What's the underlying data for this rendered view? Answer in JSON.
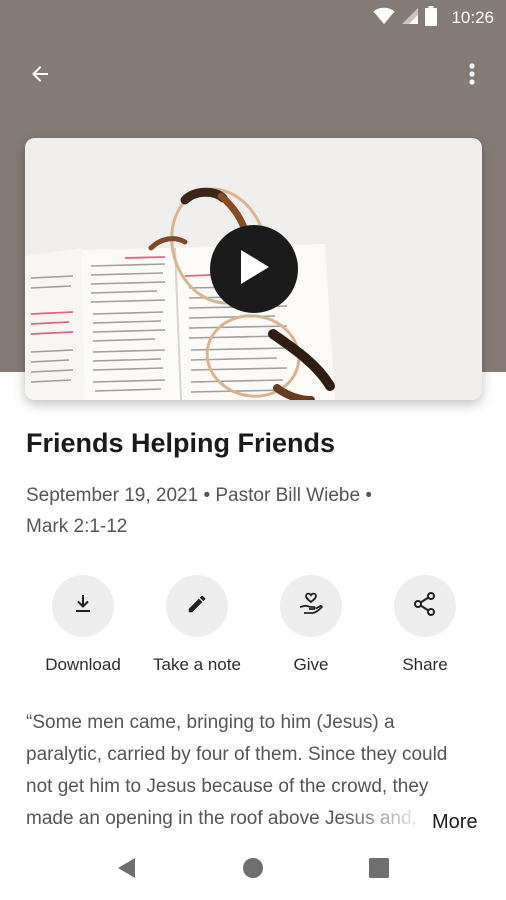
{
  "status_bar": {
    "time": "10:26"
  },
  "app_bar": {
    "back_icon": "arrow-left-icon",
    "menu_icon": "more-vertical-icon",
    "header_color": "#857b76"
  },
  "video": {
    "thumbnail": "open-bible-with-glasses",
    "play_icon": "play-icon"
  },
  "sermon": {
    "title": "Friends Helping Friends",
    "meta_line1": "September 19, 2021 • Pastor Bill Wiebe •",
    "meta_line2": "Mark 2:1-12"
  },
  "actions": [
    {
      "label": "Download",
      "icon": "download-icon"
    },
    {
      "label": "Take a note",
      "icon": "pencil-icon"
    },
    {
      "label": "Give",
      "icon": "hand-heart-icon"
    },
    {
      "label": "Share",
      "icon": "share-icon"
    }
  ],
  "description": {
    "text": "“Some men came, bringing to him (Jesus) a paralytic, carried by four of them. Since they could not get him to Jesus because of the crowd, they made an opening in the roof above Jesus and, after digging through it, lowered the mat",
    "more_label": "More"
  },
  "nav_bar": {
    "back_icon": "nav-back-icon",
    "home_icon": "nav-home-icon",
    "recents_icon": "nav-recents-icon"
  }
}
